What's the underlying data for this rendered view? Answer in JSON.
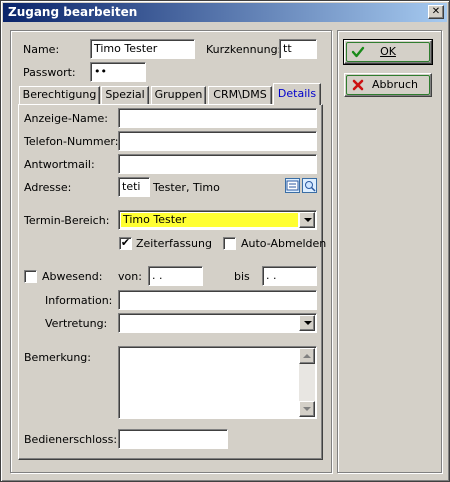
{
  "window": {
    "title": "Zugang bearbeiten",
    "close_glyph": "✕"
  },
  "header": {
    "name_label": "Name:",
    "name_value": "Timo Tester",
    "kurz_label": "Kurzkennung:",
    "kurz_value": "tt",
    "passwort_label": "Passwort:",
    "passwort_value": "••"
  },
  "tabs": [
    {
      "label": "Berechtigung"
    },
    {
      "label": "Spezial"
    },
    {
      "label": "Gruppen"
    },
    {
      "label": "CRM\\DMS"
    },
    {
      "label": "Details",
      "active": true
    }
  ],
  "details": {
    "anzeige_label": "Anzeige-Name:",
    "anzeige_value": "",
    "telefon_label": "Telefon-Nummer:",
    "telefon_value": "",
    "antwort_label": "Antwortmail:",
    "antwort_value": "",
    "adresse_label": "Adresse:",
    "adresse_code": "teti",
    "adresse_name": "Tester, Timo",
    "termin_label": "Termin-Bereich:",
    "termin_value": "Timo Tester",
    "termin_color": "#ffff33",
    "zeiterfassung_label": "Zeiterfassung",
    "zeiterfassung_checked": true,
    "autoabmelden_label": "Auto-Abmelden",
    "autoabmelden_checked": false,
    "abwesend_label": "Abwesend:",
    "abwesend_checked": false,
    "von_label": "von:",
    "von_value": " .  .",
    "bis_label": "bis",
    "bis_value": " .  .",
    "information_label": "Information:",
    "information_value": "",
    "vertretung_label": "Vertretung:",
    "vertretung_value": "",
    "bemerkung_label": "Bemerkung:",
    "bemerkung_value": "",
    "bedienerschloss_label": "Bedienerschloss:",
    "bedienerschloss_value": "",
    "check_glyph": "✔"
  },
  "buttons": {
    "ok_label": "OK",
    "abbruch_label": "Abbruch"
  }
}
